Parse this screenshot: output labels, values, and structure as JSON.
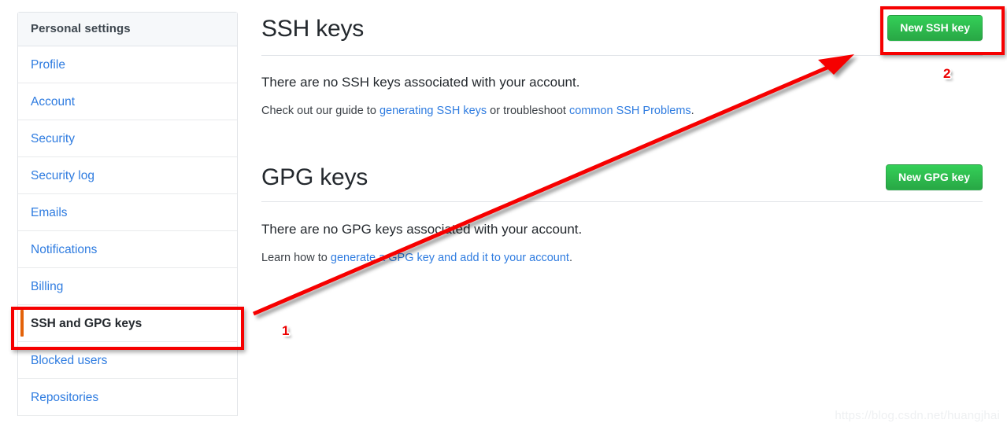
{
  "sidebar": {
    "header": "Personal settings",
    "items": [
      {
        "label": "Profile",
        "selected": false
      },
      {
        "label": "Account",
        "selected": false
      },
      {
        "label": "Security",
        "selected": false
      },
      {
        "label": "Security log",
        "selected": false
      },
      {
        "label": "Emails",
        "selected": false
      },
      {
        "label": "Notifications",
        "selected": false
      },
      {
        "label": "Billing",
        "selected": false
      },
      {
        "label": "SSH and GPG keys",
        "selected": true
      },
      {
        "label": "Blocked users",
        "selected": false
      },
      {
        "label": "Repositories",
        "selected": false
      }
    ]
  },
  "ssh": {
    "title": "SSH keys",
    "button": "New SSH key",
    "empty": "There are no SSH keys associated with your account.",
    "help_prefix": "Check out our guide to ",
    "help_link1": "generating SSH keys",
    "help_middle": " or troubleshoot ",
    "help_link2": "common SSH Problems",
    "help_suffix": "."
  },
  "gpg": {
    "title": "GPG keys",
    "button": "New GPG key",
    "empty": "There are no GPG keys associated with your account.",
    "help_prefix": "Learn how to ",
    "help_link1": "generate a GPG key and add it to your account",
    "help_suffix": "."
  },
  "annotations": {
    "marker_one": "1",
    "marker_two": "2",
    "box_color": "#f60000",
    "arrow_color": "#f60000"
  },
  "watermark": "https://blog.csdn.net/huangjhai",
  "colors": {
    "accent_green": "#28a745",
    "link_blue": "#2f7ce0",
    "selected_orange": "#e36209",
    "panel_header_bg": "#f6f8fa",
    "border": "#e1e4e8"
  }
}
